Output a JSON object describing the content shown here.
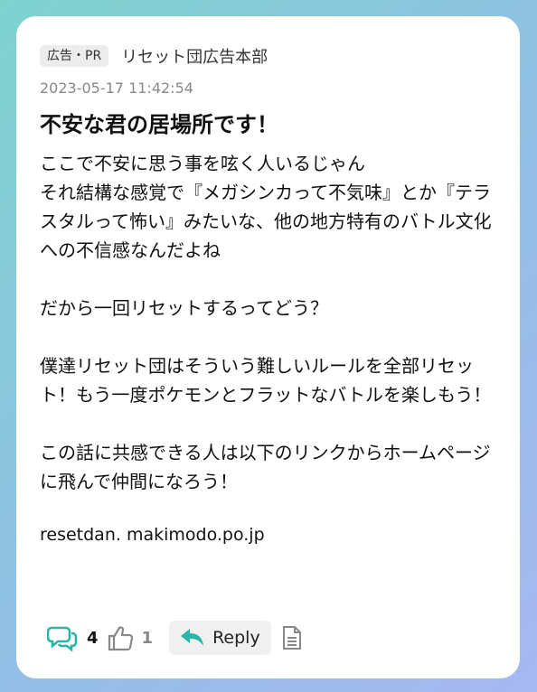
{
  "post": {
    "tag": "広告・PR",
    "author": "リセット団広告本部",
    "timestamp": "2023-05-17 11:42:54",
    "title": "不安な君の居場所です！",
    "body": "ここで不安に思う事を呟く人いるじゃん\nそれ結構な感覚で『メガシンカって不気味』とか『テラスタルって怖い』みたいな、他の地方特有のバトル文化への不信感なんだよね\n\nだから一回リセットするってどう？\n\n僕達リセット団はそういう難しいルールを全部リセット！もう一度ポケモンとフラットなバトルを楽しもう！\n\nこの話に共感できる人は以下のリンクからホームページに飛んで仲間になろう！",
    "link": "resetdan. makimodo.po.jp"
  },
  "actions": {
    "comments_icon": "comments-icon",
    "comments_count": "4",
    "like_icon": "thumbs-up-icon",
    "like_count": "1",
    "reply_icon": "reply-arrow-icon",
    "reply_label": "Reply",
    "doc_icon": "document-icon"
  },
  "colors": {
    "accent": "#2bb5a8",
    "muted": "#888888"
  }
}
